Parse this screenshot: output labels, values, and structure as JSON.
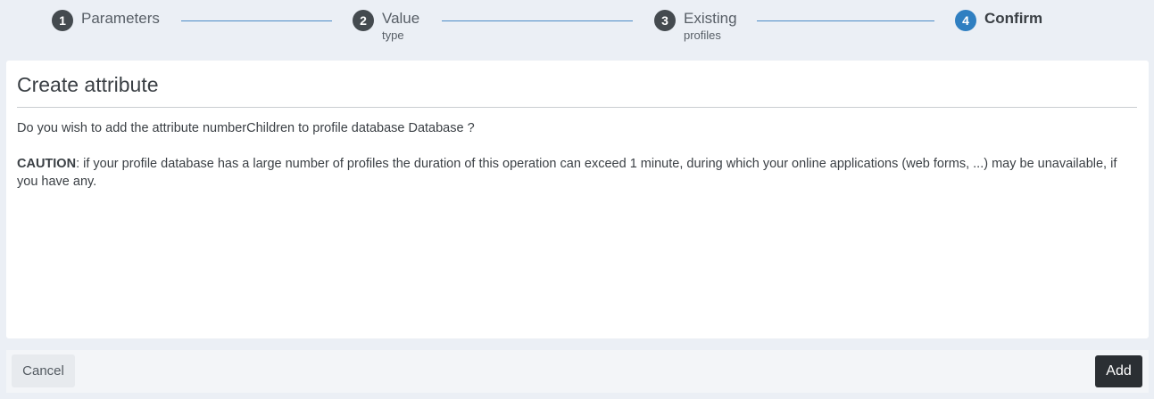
{
  "stepper": {
    "steps": [
      {
        "number": "1",
        "label": "Parameters",
        "sub": ""
      },
      {
        "number": "2",
        "label": "Value",
        "sub": "type"
      },
      {
        "number": "3",
        "label": "Existing",
        "sub": "profiles"
      },
      {
        "number": "4",
        "label": "Confirm",
        "sub": ""
      }
    ],
    "active_step": 4
  },
  "dialog": {
    "title": "Create attribute",
    "question": "Do you wish to add the attribute numberChildren to profile database Database ?",
    "caution_label": "CAUTION",
    "caution_text": ": if your profile database has a large number of profiles the duration of this operation can exceed 1 minute, during which your online applications (web forms, ...) may be unavailable, if you have any."
  },
  "footer": {
    "cancel_label": "Cancel",
    "add_label": "Add"
  },
  "colors": {
    "active_step": "#2f7fc1",
    "inactive_step": "#444a4f",
    "connector": "#4a8ac6",
    "primary_button": "#2b2f33"
  }
}
